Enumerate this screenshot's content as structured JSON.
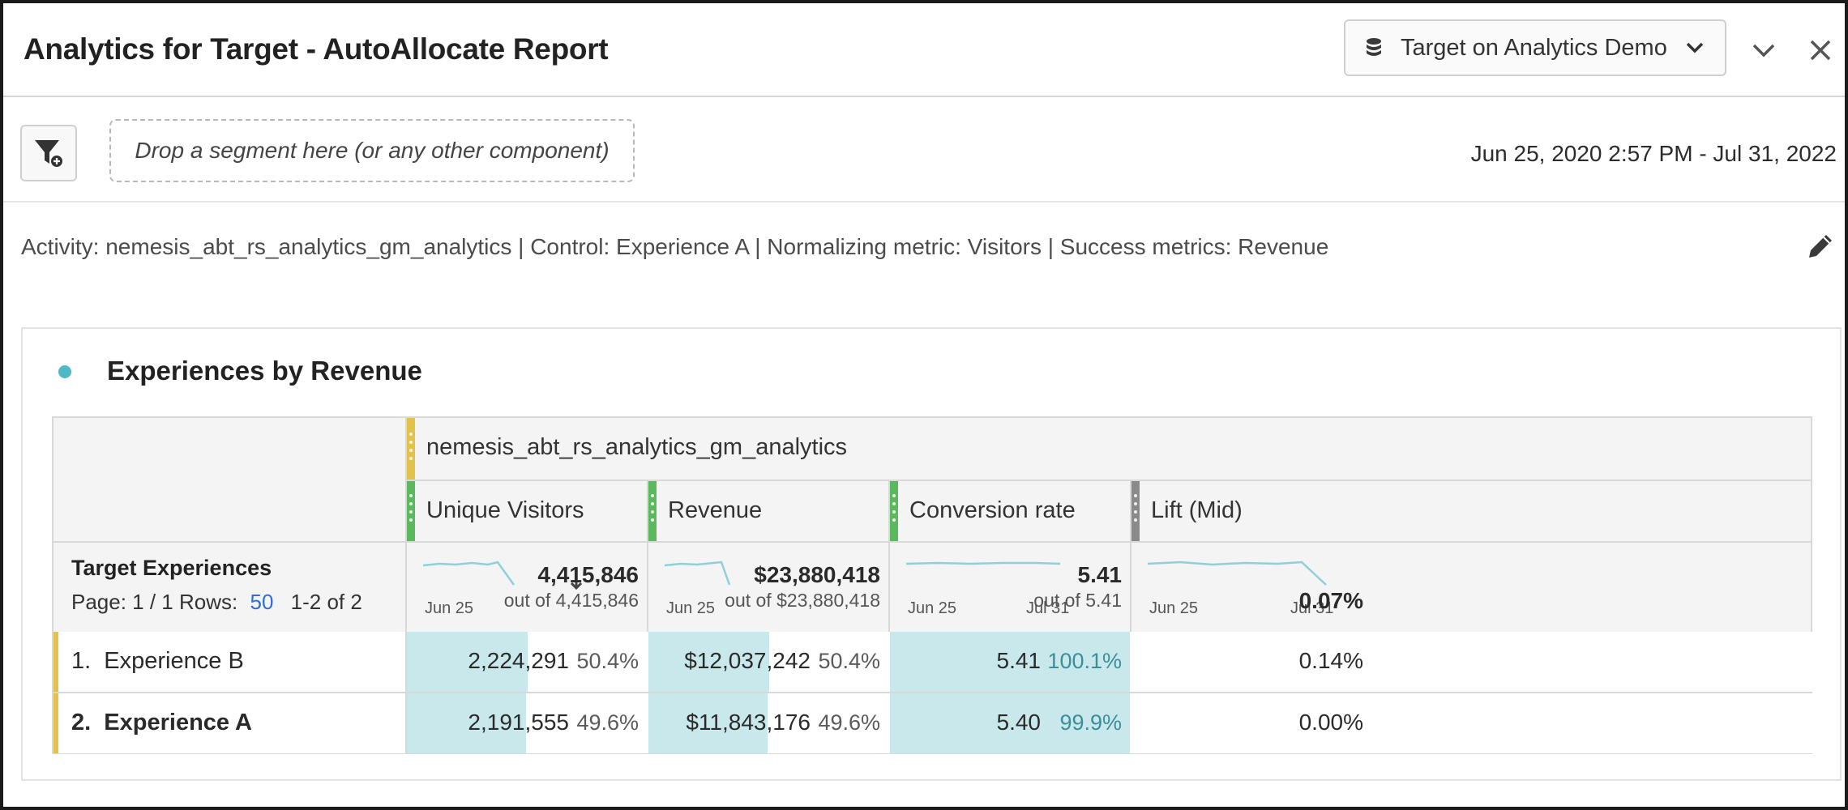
{
  "header": {
    "title": "Analytics for Target - AutoAllocate Report",
    "report_suite": "Target on Analytics Demo"
  },
  "segment_bar": {
    "drop_placeholder": "Drop a segment here (or any other component)",
    "date_range": "Jun 25, 2020 2:57 PM - Jul 31, 2022"
  },
  "description": "Activity: nemesis_abt_rs_analytics_gm_analytics | Control: Experience A | Normalizing metric: Visitors | Success metrics: Revenue",
  "panel": {
    "title": "Experiences by Revenue",
    "accent_color": "#4fb9c6"
  },
  "table": {
    "dimension_group": "nemesis_abt_rs_analytics_gm_analytics",
    "dimension_label": "Target Experiences",
    "pagination": {
      "page_label": "Page: 1 / 1",
      "rows_label": "Rows:",
      "rows_value": "50",
      "range": "1-2 of 2"
    },
    "columns": [
      {
        "name": "Unique Visitors",
        "total": "4,415,846",
        "out_of": "out of 4,415,846",
        "date_start": "Jun 25",
        "date_end": "",
        "sorted": true,
        "color": "#5cb85c"
      },
      {
        "name": "Revenue",
        "total": "$23,880,418",
        "out_of": "out of $23,880,418",
        "date_start": "Jun 25",
        "date_end": "",
        "sorted": false,
        "color": "#5cb85c"
      },
      {
        "name": "Conversion rate",
        "total": "5.41",
        "out_of": "out of 5.41",
        "date_start": "Jun 25",
        "date_end": "Jul 31",
        "sorted": false,
        "color": "#5cb85c"
      },
      {
        "name": "Lift (Mid)",
        "total": "0.07%",
        "out_of": "",
        "date_start": "Jun 25",
        "date_end": "Jul 31",
        "sorted": false,
        "color": "#8a8a8a"
      }
    ],
    "rows": [
      {
        "label": "1.  Experience B",
        "bold": false,
        "values": [
          {
            "value": "2,224,291",
            "pct": "50.4%",
            "fill": 0.504
          },
          {
            "value": "$12,037,242",
            "pct": "50.4%",
            "fill": 0.504
          },
          {
            "value": "5.41",
            "pct": "100.1%",
            "fill": 1.0
          },
          {
            "value": "0.14%",
            "pct": "",
            "fill": 0
          }
        ]
      },
      {
        "label": "2.  Experience A",
        "bold": true,
        "values": [
          {
            "value": "2,191,555",
            "pct": "49.6%",
            "fill": 0.496
          },
          {
            "value": "$11,843,176",
            "pct": "49.6%",
            "fill": 0.496
          },
          {
            "value": "5.40",
            "pct": "99.9%",
            "fill": 0.999
          },
          {
            "value": "0.00%",
            "pct": "",
            "fill": 0
          }
        ]
      }
    ]
  },
  "colors": {
    "dimension_accent": "#e2c24a",
    "metric_accent": "#5cb85c",
    "bar_fill": "#c9e8ec",
    "sparkline": "#8fd0d8"
  }
}
